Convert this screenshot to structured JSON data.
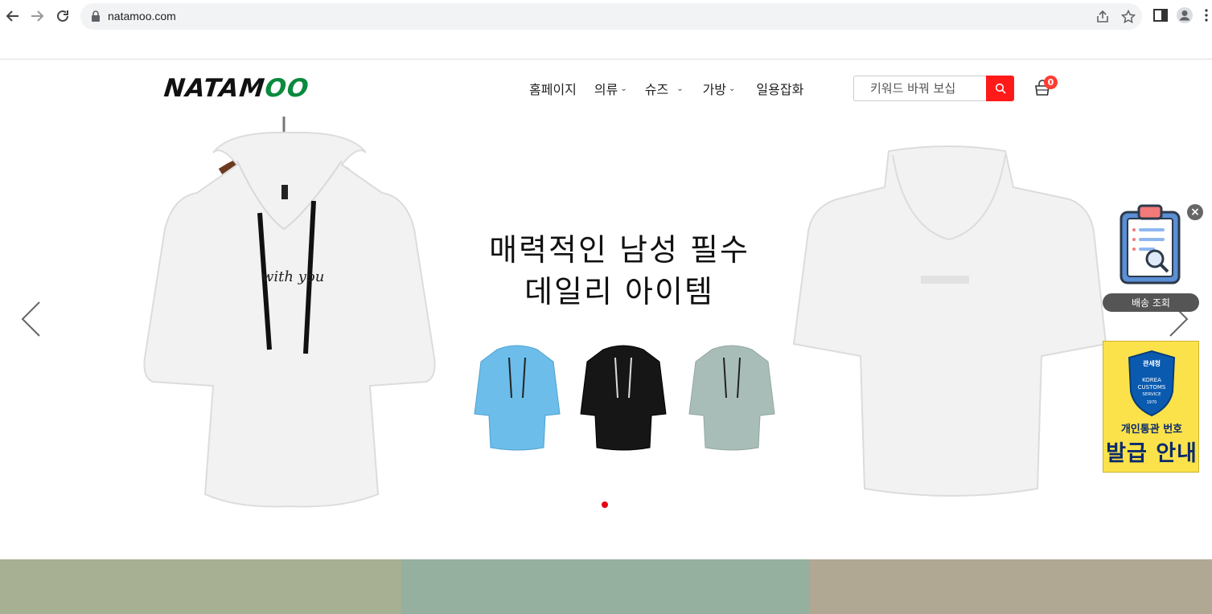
{
  "browser": {
    "url": "natamoo.com"
  },
  "header": {
    "logo_part1": "NATAM",
    "logo_part2": "OO",
    "menu": [
      {
        "label": "홈페이지",
        "dropdown": false
      },
      {
        "label": "의류",
        "dropdown": true
      },
      {
        "label": "슈즈",
        "dropdown": true
      },
      {
        "label": "가방",
        "dropdown": true
      },
      {
        "label": "일용잡화",
        "dropdown": false
      }
    ],
    "search_placeholder": "키워드 바꿔 보십",
    "cart_count": "0"
  },
  "slider": {
    "headline_line1": "매력적인 남성 필수",
    "headline_line2": "데일리 아이템",
    "shirt_colors": {
      "white": "#f4f4f4",
      "blue": "#6cbde9",
      "black": "#161616",
      "gray": "#a9bdb8"
    },
    "accent": "#e60012"
  },
  "widgets": {
    "delivery_label": "배송 조회",
    "customs_badge_top": "관세청",
    "customs_badge_line1": "KOREA",
    "customs_badge_line2": "CUSTOMS",
    "customs_badge_line3": "SERVICE",
    "customs_badge_year": "1970",
    "customs_line1": "개인통관 번호",
    "customs_line2": "발급 안내"
  },
  "bands": [
    "#a7b092",
    "#96b0a0",
    "#b0a892"
  ],
  "icons": {
    "back": "arrow-left-icon",
    "forward": "arrow-right-icon",
    "reload": "reload-icon",
    "lock": "lock-icon",
    "share": "share-icon",
    "star": "star-icon",
    "sidepanel": "side-panel-icon",
    "profile": "profile-icon",
    "menu": "kebab-menu-icon",
    "search": "search-icon",
    "cart": "shopping-bag-icon"
  }
}
